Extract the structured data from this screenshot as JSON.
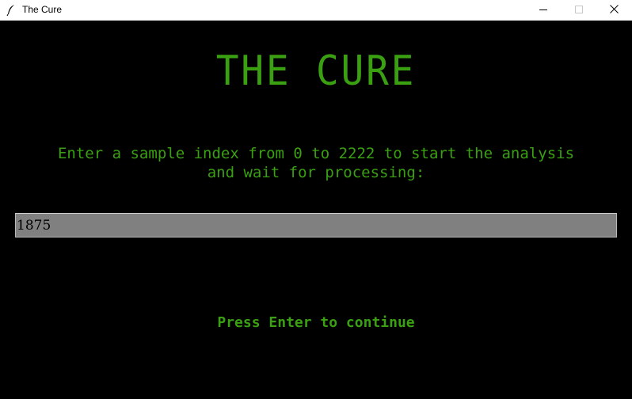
{
  "window": {
    "title": "The Cure",
    "icons": {
      "app": "feather-icon",
      "minimize": "minimize-icon",
      "maximize": "maximize-icon",
      "close": "close-icon"
    }
  },
  "main": {
    "heading": "THE CURE",
    "instructions": "Enter a sample index from 0 to 2222 to start the analysis and wait for processing:",
    "index_input": {
      "value": "1875",
      "placeholder": ""
    },
    "continue_prompt": "Press Enter to continue"
  },
  "colors": {
    "background": "#000000",
    "text_green": "#3aa012",
    "input_bg": "#808080",
    "titlebar_bg": "#ffffff"
  }
}
